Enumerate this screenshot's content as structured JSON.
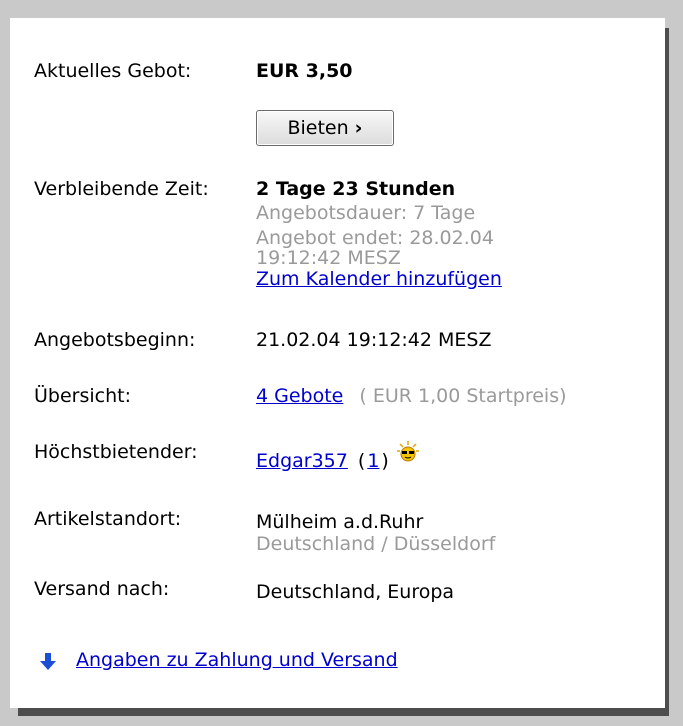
{
  "current_bid": {
    "label": "Aktuelles Gebot:",
    "value": "EUR 3,50"
  },
  "bid_button": {
    "label": "Bieten",
    "arrow": "›"
  },
  "time_left": {
    "label": "Verbleibende Zeit:",
    "value": "2 Tage 23 Stunden",
    "duration": "Angebotsdauer: 7 Tage",
    "ends_line1": "Angebot endet: 28.02.04",
    "ends_line2": "19:12:42 MESZ",
    "calendar_link": "Zum Kalender hinzufügen"
  },
  "start": {
    "label": "Angebotsbeginn:",
    "value": "21.02.04 19:12:42 MESZ"
  },
  "overview": {
    "label": "Übersicht:",
    "bids_link": "4 Gebote",
    "start_price": "( EUR 1,00 Startpreis)"
  },
  "high_bidder": {
    "label": "Höchstbietender:",
    "name": "Edgar357",
    "open_paren": "(",
    "feedback": "1",
    "close_paren": ")",
    "icon": "new-member-sunglasses-icon"
  },
  "location": {
    "label": "Artikelstandort:",
    "city": "Mülheim a.d.Ruhr",
    "region": "Deutschland / Düsseldorf"
  },
  "shipping": {
    "label": "Versand nach:",
    "value": "Deutschland, Europa"
  },
  "payment_link": {
    "label": "Angaben zu Zahlung und Versand",
    "icon": "arrow-down-icon"
  },
  "colors": {
    "link": "#0000cc",
    "grey": "#9a9a9a",
    "background": "#c9c9c9"
  }
}
